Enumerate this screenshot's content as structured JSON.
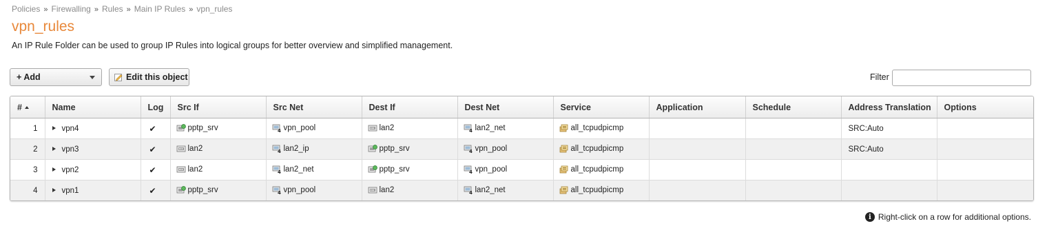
{
  "breadcrumb": {
    "items": [
      "Policies",
      "Firewalling",
      "Rules",
      "Main IP Rules",
      "vpn_rules"
    ],
    "separator": "»"
  },
  "page": {
    "title": "vpn_rules",
    "description": "An IP Rule Folder can be used to group IP Rules into logical groups for better overview and simplified management."
  },
  "toolbar": {
    "add_label": "Add",
    "add_prefix": "+",
    "edit_label": "Edit this object",
    "filter_label": "Filter",
    "filter_value": ""
  },
  "table": {
    "columns": [
      "#",
      "Name",
      "Log",
      "Src If",
      "Src Net",
      "Dest If",
      "Dest Net",
      "Service",
      "Application",
      "Schedule",
      "Address Translation",
      "Options"
    ],
    "rows": [
      {
        "num": "1",
        "name": "vpn4",
        "log": "✔",
        "src_if": "pptp_srv",
        "src_if_icon": "interface-pptp-icon",
        "src_net": "vpn_pool",
        "dest_if": "lan2",
        "dest_if_icon": "interface-eth-icon",
        "dest_net": "lan2_net",
        "service": "all_tcpudpicmp",
        "application": "",
        "schedule": "",
        "address_translation": "SRC:Auto",
        "options": ""
      },
      {
        "num": "2",
        "name": "vpn3",
        "log": "✔",
        "src_if": "lan2",
        "src_if_icon": "interface-eth-icon",
        "src_net": "lan2_ip",
        "dest_if": "pptp_srv",
        "dest_if_icon": "interface-pptp-icon",
        "dest_net": "vpn_pool",
        "service": "all_tcpudpicmp",
        "application": "",
        "schedule": "",
        "address_translation": "SRC:Auto",
        "options": ""
      },
      {
        "num": "3",
        "name": "vpn2",
        "log": "✔",
        "src_if": "lan2",
        "src_if_icon": "interface-eth-icon",
        "src_net": "lan2_net",
        "dest_if": "pptp_srv",
        "dest_if_icon": "interface-pptp-icon",
        "dest_net": "vpn_pool",
        "service": "all_tcpudpicmp",
        "application": "",
        "schedule": "",
        "address_translation": "",
        "options": ""
      },
      {
        "num": "4",
        "name": "vpn1",
        "log": "✔",
        "src_if": "pptp_srv",
        "src_if_icon": "interface-pptp-icon",
        "src_net": "vpn_pool",
        "dest_if": "lan2",
        "dest_if_icon": "interface-eth-icon",
        "dest_net": "lan2_net",
        "service": "all_tcpudpicmp",
        "application": "",
        "schedule": "",
        "address_translation": "",
        "options": ""
      }
    ]
  },
  "footer": {
    "hint": "Right-click on a row for additional options."
  },
  "colors": {
    "title": "#e8883a",
    "alt_row": "#f0f0f0",
    "border": "#b5b5b5"
  }
}
